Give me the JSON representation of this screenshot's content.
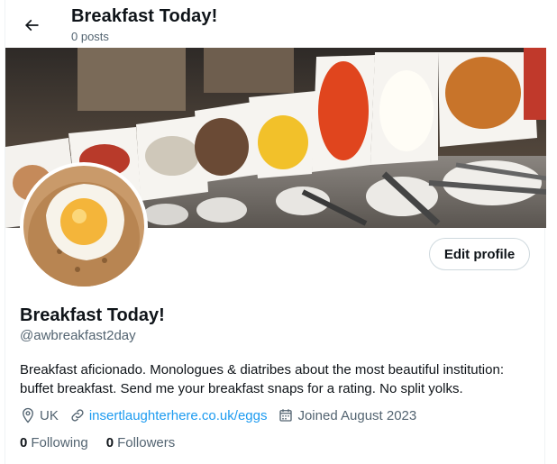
{
  "header": {
    "title": "Breakfast Today!",
    "post_count": "0 posts"
  },
  "profile": {
    "name": "Breakfast Today!",
    "handle": "@awbreakfast2day",
    "bio": "Breakfast aficionado. Monologues & diatribes about the most beautiful institution: buffet breakfast. Send me your breakfast snaps for a rating. No split yolks.",
    "edit_label": "Edit profile",
    "location": "UK",
    "website": "insertlaughterhere.co.uk/eggs",
    "joined": "Joined August 2023",
    "following_count": "0",
    "following_label": "Following",
    "followers_count": "0",
    "followers_label": "Followers"
  },
  "icons": {
    "back": "arrow-left-icon",
    "location": "map-pin-icon",
    "website": "link-icon",
    "joined": "calendar-icon"
  },
  "colors": {
    "text": "#0f1419",
    "secondary": "#536471",
    "link": "#1d9bf0",
    "border": "#cfd9de"
  }
}
